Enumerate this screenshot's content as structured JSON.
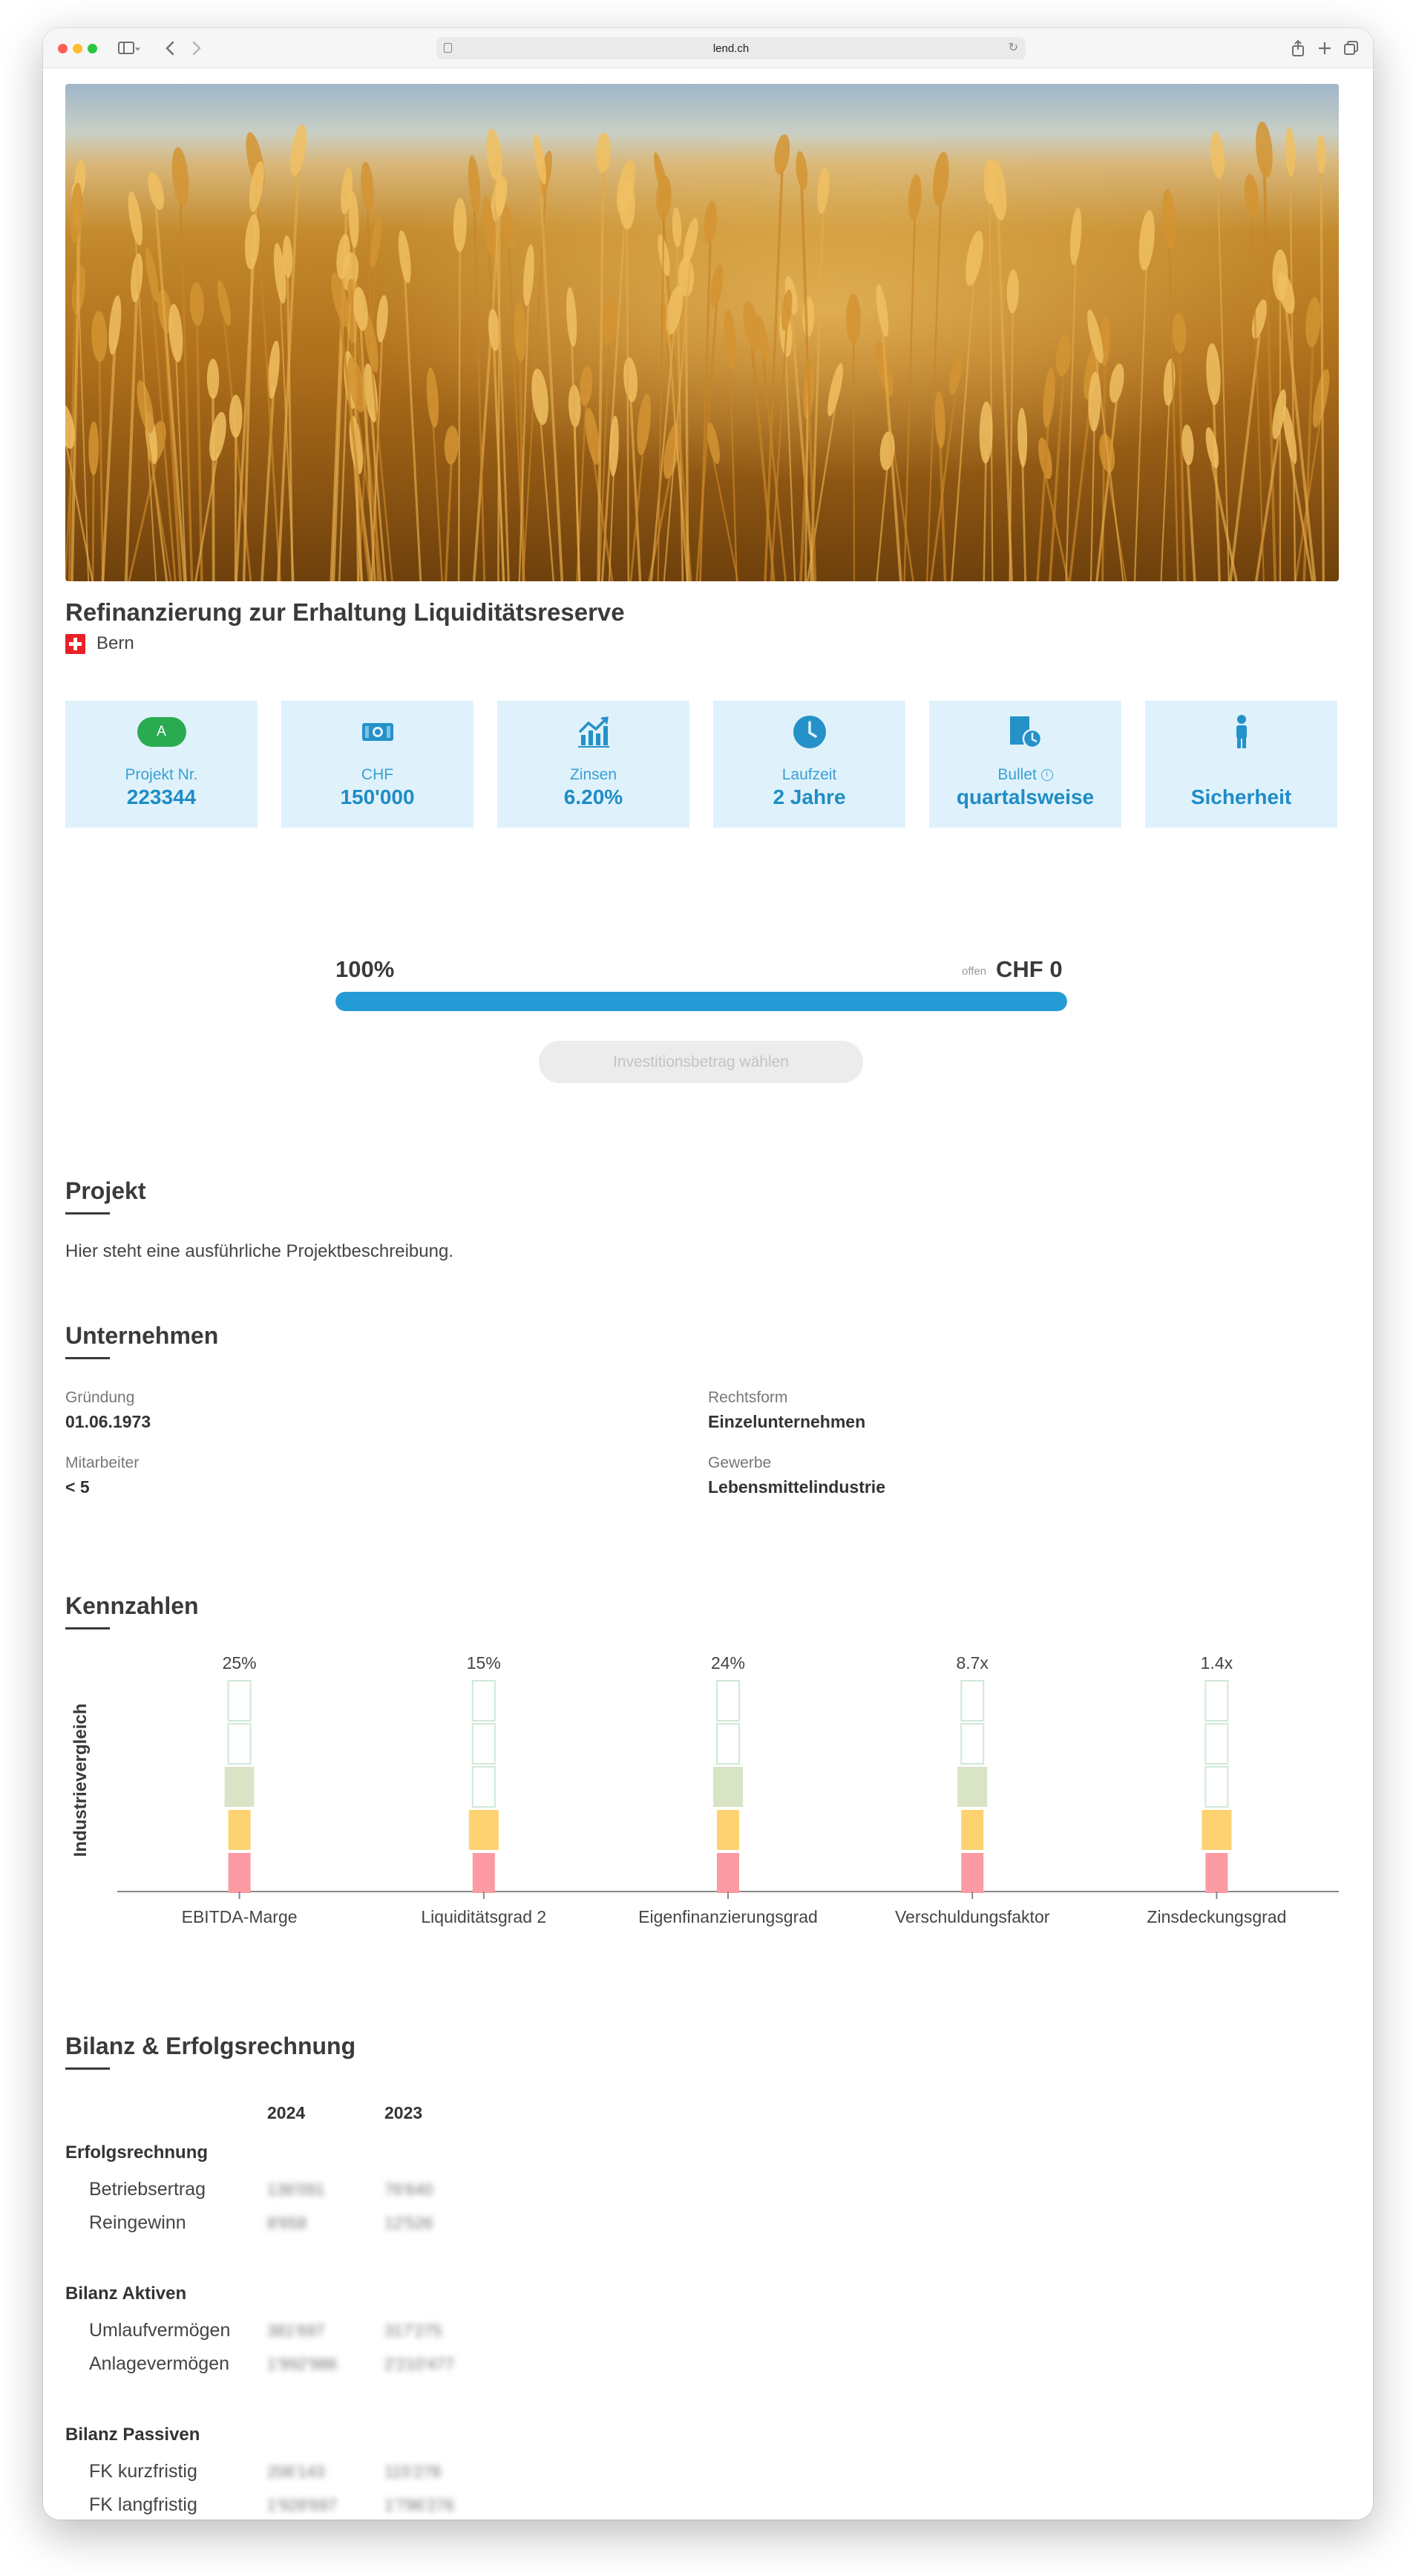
{
  "browser": {
    "url": "lend.ch"
  },
  "project": {
    "title": "Refinanzierung zur Erhaltung Liquiditätsreserve",
    "location": "Bern"
  },
  "cards": [
    {
      "icon": "grade-badge",
      "badge": "A",
      "label": "Projekt Nr.",
      "value": "223344"
    },
    {
      "icon": "banknote-icon",
      "label": "CHF",
      "value": "150'000"
    },
    {
      "icon": "chart-trend-icon",
      "label": "Zinsen",
      "value": "6.20%"
    },
    {
      "icon": "clock-icon",
      "label": "Laufzeit",
      "value": "2 Jahre"
    },
    {
      "icon": "calendar-clock-icon",
      "label": "Bullet",
      "value": "quartalsweise"
    },
    {
      "icon": "person-icon",
      "label": "",
      "value": "Sicherheit"
    }
  ],
  "funding": {
    "percent_label": "100%",
    "progress": 1.0,
    "open_label": "offen",
    "open_value": "CHF 0",
    "button_label": "Investitionsbetrag wählen"
  },
  "sections": {
    "projekt_title": "Projekt",
    "projekt_text": "Hier steht eine ausführliche Projektbeschreibung.",
    "unternehmen_title": "Unternehmen",
    "kennzahlen_title": "Kennzahlen",
    "bilanz_title": "Bilanz & Erfolgsrechnung"
  },
  "company": {
    "founding_label": "Gründung",
    "founding_value": "01.06.1973",
    "legal_label": "Rechtsform",
    "legal_value": "Einzelunternehmen",
    "staff_label": "Mitarbeiter",
    "staff_value": "< 5",
    "trade_label": "Gewerbe",
    "trade_value": "Lebensmittelindustrie"
  },
  "chart_data": {
    "type": "bar",
    "ylabel": "Industrievergleich",
    "categories": [
      "EBITDA-Marge",
      "Liquiditätsgrad 2",
      "Eigenfinanzierungsgrad",
      "Verschuldungsfaktor",
      "Zinsdeckungsgrad"
    ],
    "value_labels": [
      "25%",
      "15%",
      "24%",
      "8.7x",
      "1.4x"
    ],
    "levels": 5,
    "level_colors": [
      "#fb9aa2",
      "#fdd372",
      "#d9e4c6",
      "#ffffff",
      "#ffffff"
    ],
    "highlighted_level": [
      3,
      2,
      3,
      3,
      2
    ],
    "grid": false
  },
  "financials": {
    "years": [
      "2024",
      "2023"
    ],
    "groups": [
      {
        "name": "Erfolgsrechnung",
        "rows": [
          {
            "label": "Betriebsertrag",
            "values": [
              "136'091",
              "76'640"
            ]
          },
          {
            "label": "Reingewinn",
            "values": [
              "8'658",
              "12'526"
            ]
          }
        ]
      },
      {
        "name": "Bilanz Aktiven",
        "rows": [
          {
            "label": "Umlaufvermögen",
            "values": [
              "381'697",
              "317'275"
            ]
          },
          {
            "label": "Anlagevermögen",
            "values": [
              "1'992'986",
              "2'210'477"
            ]
          }
        ]
      },
      {
        "name": "Bilanz Passiven",
        "rows": [
          {
            "label": "FK kurzfristig",
            "values": [
              "206'143",
              "115'278"
            ]
          },
          {
            "label": "FK langfristig",
            "values": [
              "1'928'697",
              "1'796'276"
            ]
          }
        ]
      }
    ]
  },
  "colors": {
    "accent": "#259bd5",
    "card_bg": "#dff2fb",
    "badge_green": "#2bab51"
  }
}
